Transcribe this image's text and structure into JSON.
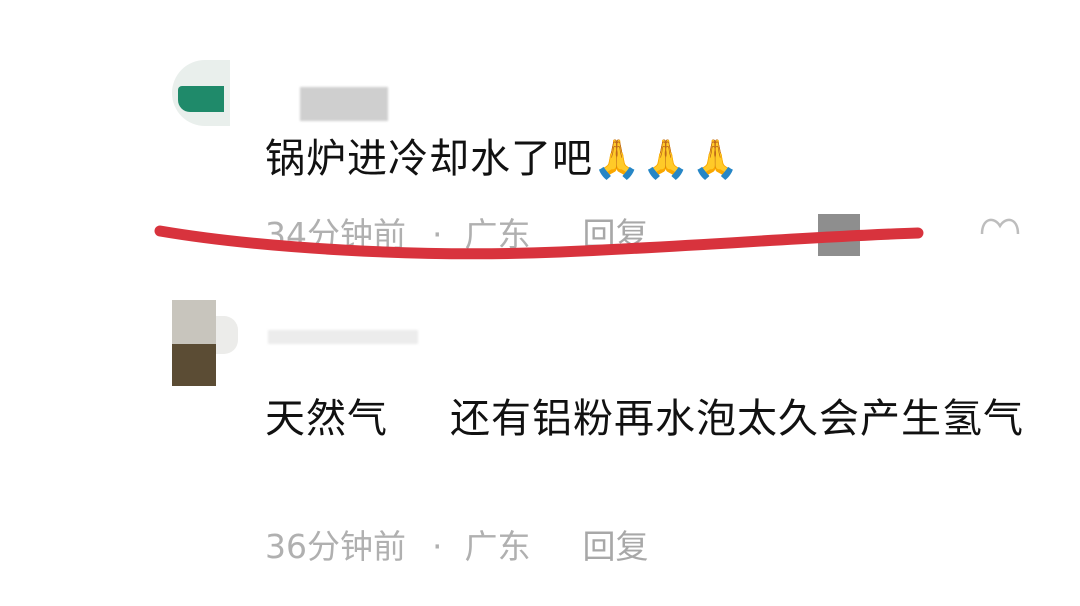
{
  "comments": [
    {
      "text": "锅炉进冷却水了吧",
      "emoji": "🙏🙏🙏",
      "time": "34分钟前",
      "separator": "·",
      "location": "广东",
      "reply_label": "回复"
    },
    {
      "text_part1": "天然气",
      "text_part2": "还有铝粉再水泡太久会产生氢气",
      "time": "36分钟前",
      "separator": "·",
      "location": "广东",
      "reply_label": "回复"
    }
  ],
  "colors": {
    "highlight_stroke": "#d8333d",
    "meta_text": "#b0b0b0"
  }
}
